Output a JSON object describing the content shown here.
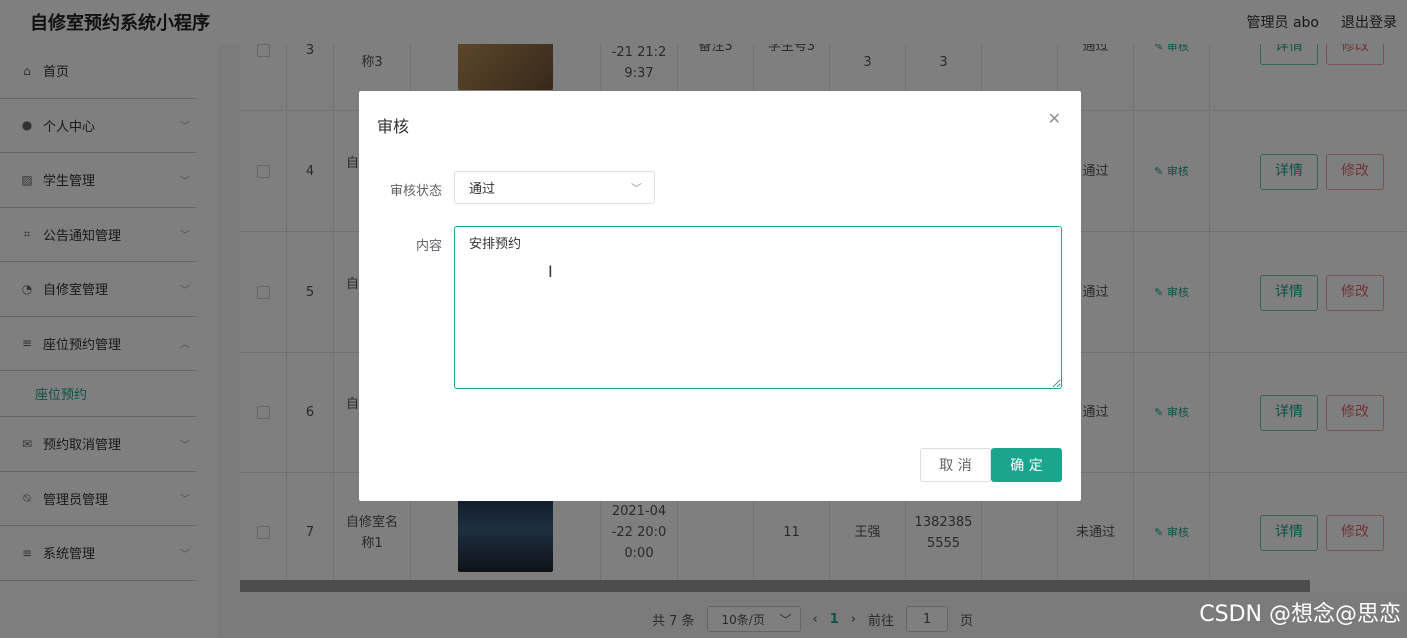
{
  "header": {
    "app_title": "自修室预约系统小程序",
    "user": "管理员 abo",
    "logout": "退出登录"
  },
  "sidebar": {
    "items": [
      {
        "label": "首页",
        "icon": "home-icon"
      },
      {
        "label": "个人中心",
        "icon": "user-icon"
      },
      {
        "label": "学生管理",
        "icon": "chart-icon"
      },
      {
        "label": "公告通知管理",
        "icon": "crop-icon"
      },
      {
        "label": "自修室管理",
        "icon": "gauge-icon"
      },
      {
        "label": "座位预约管理",
        "icon": "list-icon"
      },
      {
        "label": "预约取消管理",
        "icon": "mail-icon"
      },
      {
        "label": "管理员管理",
        "icon": "bell-off-icon"
      },
      {
        "label": "系统管理",
        "icon": "list-icon"
      }
    ],
    "sub_active": "座位预约"
  },
  "table": {
    "rows": [
      {
        "idx": "3",
        "name_lines": [
          "称3"
        ],
        "time_lines": [
          "-21 21:2",
          "9:37"
        ],
        "remark": "备注3",
        "student_no": "学生号3",
        "count": "3",
        "phone": "3",
        "status": "通过",
        "thumb_color": "#b08a55"
      },
      {
        "idx": "4",
        "name_lines": [
          "自"
        ],
        "time_lines": [],
        "remark": "",
        "student_no": "",
        "count": "",
        "phone": "",
        "status": "通过",
        "thumb_color": ""
      },
      {
        "idx": "5",
        "name_lines": [
          "自"
        ],
        "time_lines": [],
        "remark": "",
        "student_no": "",
        "count": "",
        "phone": "",
        "status": "通过",
        "thumb_color": ""
      },
      {
        "idx": "6",
        "name_lines": [
          "自"
        ],
        "time_lines": [],
        "remark": "",
        "student_no": "",
        "count": "",
        "phone": "",
        "status": "通过",
        "thumb_color": ""
      },
      {
        "idx": "7",
        "name_lines": [
          "自修室名",
          "称1"
        ],
        "time_lines": [
          "2021-04",
          "-22 20:0",
          "0:00"
        ],
        "remark": "",
        "student_no": "11",
        "count": "王强",
        "phone": "13823855555",
        "phone_lines": [
          "1382385",
          "5555"
        ],
        "status": "未通过",
        "thumb_color": "#2e4a6b"
      }
    ],
    "audit_label": "审核",
    "detail_label": "详情",
    "edit_label": "修改"
  },
  "pager": {
    "total": "共 7 条",
    "page_size": "10条/页",
    "current": "1",
    "goto_prefix": "前往",
    "goto_value": "1",
    "goto_suffix": "页"
  },
  "dialog": {
    "title": "审核",
    "status_label": "审核状态",
    "status_value": "通过",
    "content_label": "内容",
    "content_value": "安排预约",
    "cancel": "取 消",
    "confirm": "确 定"
  },
  "watermark": "CSDN @想念@思恋",
  "colors": {
    "accent": "#1aa58e",
    "danger": "#e26a6a"
  }
}
